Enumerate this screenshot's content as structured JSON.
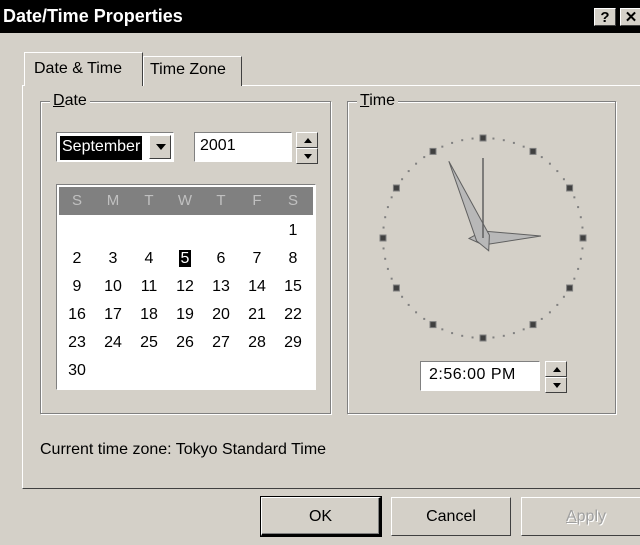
{
  "window": {
    "title": "Date/Time Properties",
    "help_label": "?",
    "close_label": "✕"
  },
  "tabs": [
    {
      "label": "Date & Time",
      "active": true
    },
    {
      "label": "Time Zone",
      "active": false
    }
  ],
  "date_group": {
    "label_prefix": "D",
    "label_rest": "ate",
    "month": "September",
    "year": "2001",
    "calendar": {
      "weekday_headers": [
        "S",
        "M",
        "T",
        "W",
        "T",
        "F",
        "S"
      ],
      "selected_day": "5",
      "weeks": [
        [
          "",
          "",
          "",
          "",
          "",
          "",
          "1"
        ],
        [
          "2",
          "3",
          "4",
          "5",
          "6",
          "7",
          "8"
        ],
        [
          "9",
          "10",
          "11",
          "12",
          "13",
          "14",
          "15"
        ],
        [
          "16",
          "17",
          "18",
          "19",
          "20",
          "21",
          "22"
        ],
        [
          "23",
          "24",
          "25",
          "26",
          "27",
          "28",
          "29"
        ],
        [
          "30",
          "",
          "",
          "",
          "",
          "",
          ""
        ]
      ]
    }
  },
  "time_group": {
    "label_prefix": "T",
    "label_rest": "ime",
    "time_value": "2:56:00 PM",
    "clock": {
      "hours": 2,
      "minutes": 56,
      "seconds": 0
    }
  },
  "current_time_zone": "Current time zone:  Tokyo Standard Time",
  "buttons": {
    "ok": "OK",
    "cancel": "Cancel",
    "apply_prefix": "A",
    "apply_rest": "pply",
    "apply_enabled": false
  },
  "colors": {
    "dialog_face": "#d4d0c8",
    "titlebar": "#000000",
    "calendar_header": "#808080",
    "selection": "#000000"
  }
}
